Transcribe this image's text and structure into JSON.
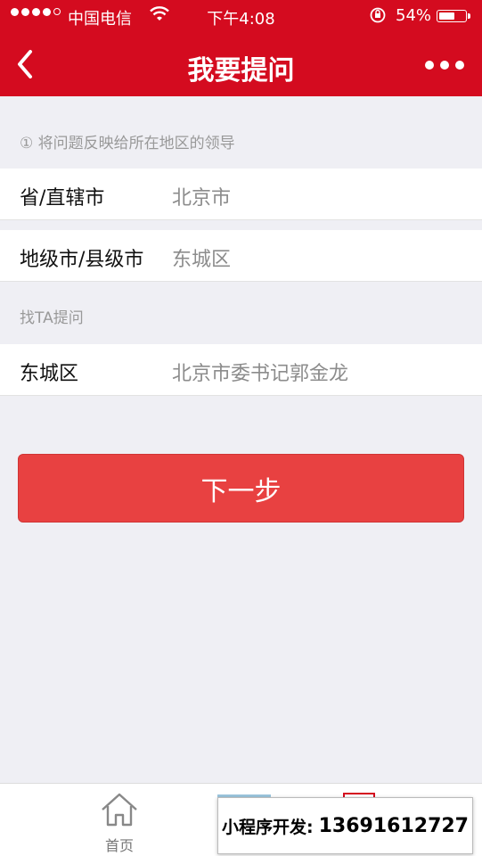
{
  "status_bar": {
    "carrier": "中国电信",
    "time": "下午4:08",
    "battery_percent": "54%",
    "battery_level": 0.54,
    "wifi_icon": "wifi-icon",
    "lock_icon": "rotation-lock-icon"
  },
  "nav": {
    "title": "我要提问",
    "back_icon": "chevron-left-icon",
    "more_icon": "more-dots-icon"
  },
  "hint": "① 将问题反映给所在地区的领导",
  "fields": [
    {
      "label": "省/直辖市",
      "value": "北京市"
    },
    {
      "label": "地级市/县级市",
      "value": "东城区"
    }
  ],
  "section_title": "找TA提问",
  "target": {
    "label": "东城区",
    "value": "北京市委书记郭金龙"
  },
  "next_button": "下一步",
  "tab_bar": {
    "home_label": "首页",
    "home_icon": "home-icon"
  },
  "overlay": {
    "text": "小程序开发:",
    "phone": "13691612727"
  },
  "colors": {
    "brand_red": "#d40b1f",
    "button_red": "#e84141",
    "background": "#efeff4"
  }
}
